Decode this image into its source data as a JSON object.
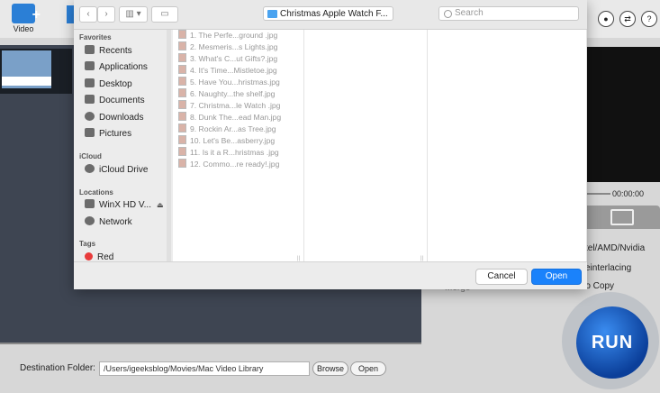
{
  "app": {
    "toolbar": {
      "video_label": "Video"
    },
    "preview_time": "00:00:00",
    "options": {
      "hw_accel": "tel/AMD/Nvidia",
      "deinterlacing": "einterlacing",
      "merge": "Merge",
      "auto_copy": "uto Copy"
    },
    "run_label": "RUN",
    "destination": {
      "label": "Destination Folder:",
      "path": "/Users/igeeksblog/Movies/Mac Video Library",
      "browse_label": "Browse",
      "open_label": "Open"
    }
  },
  "dialog": {
    "path_title": "Christmas Apple Watch F...",
    "search_placeholder": "Search",
    "sidebar": {
      "favorites_header": "Favorites",
      "favorites": [
        "Recents",
        "Applications",
        "Desktop",
        "Documents",
        "Downloads",
        "Pictures"
      ],
      "icloud_header": "iCloud",
      "icloud": [
        "iCloud Drive"
      ],
      "locations_header": "Locations",
      "locations": [
        "WinX HD V...",
        "Network"
      ],
      "tags_header": "Tags",
      "tags": [
        "Red"
      ]
    },
    "files": [
      "1. The Perfe...ground .jpg",
      "2. Mesmeris...s Lights.jpg",
      "3. What's C...ut Gifts?.jpg",
      "4. It's Time...Mistletoe.jpg",
      "5. Have You...hristmas.jpg",
      "6. Naughty...the shelf.jpg",
      "7. Christma...le Watch .jpg",
      "8. Dunk The...ead Man.jpg",
      "9. Rockin Ar...as Tree.jpg",
      "10. Let's Be...asberry.jpg",
      "11. Is it a R...hristmas .jpg",
      "12. Commo...re ready!.jpg"
    ],
    "cancel_label": "Cancel",
    "open_label": "Open"
  }
}
